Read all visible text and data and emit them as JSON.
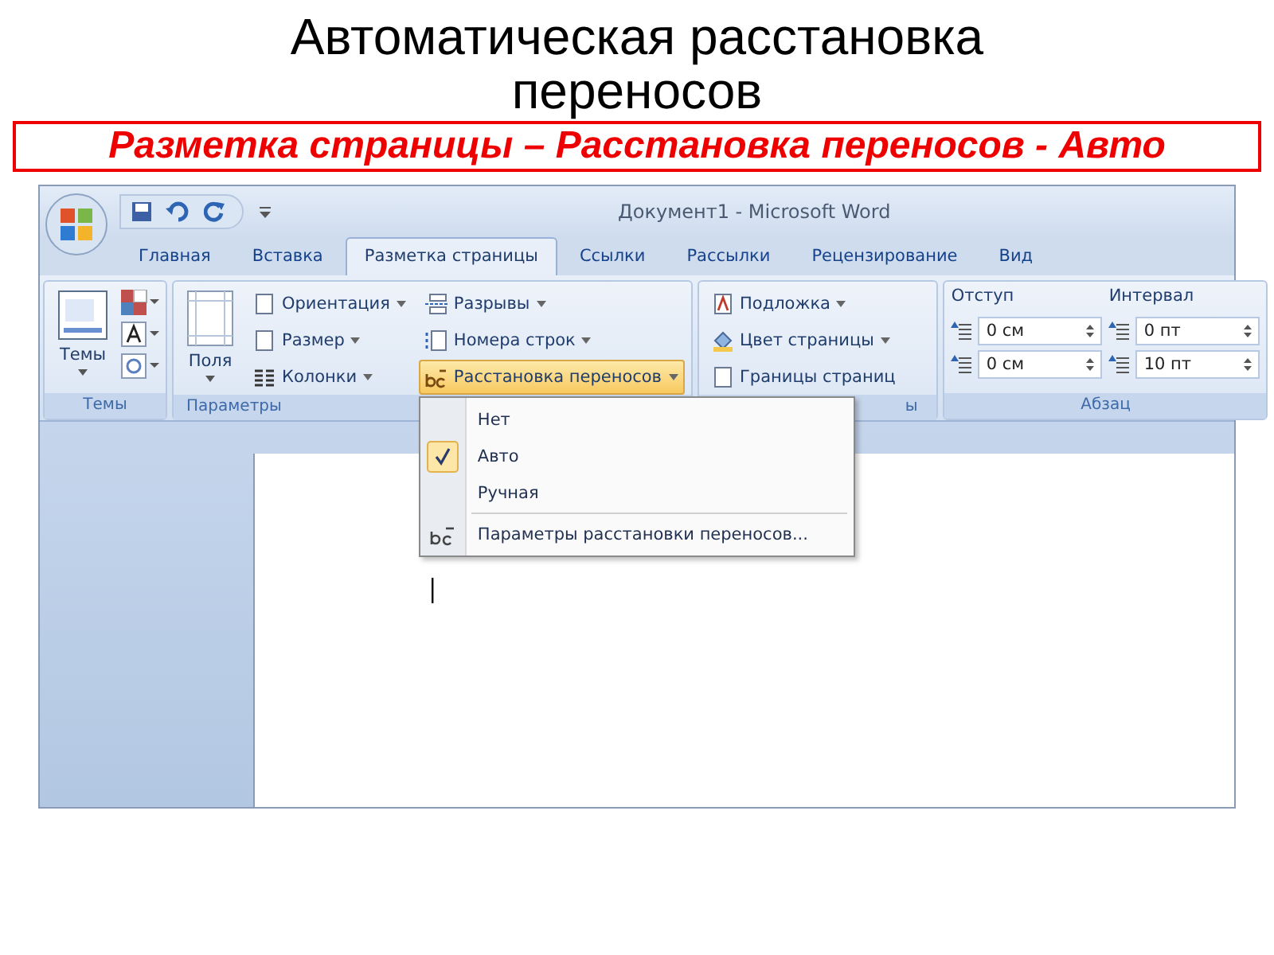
{
  "slide": {
    "title": "Автоматическая расстановка переносов",
    "subtitle": "Разметка страницы – Расстановка переносов - Авто"
  },
  "window": {
    "title": "Документ1 - Microsoft Word"
  },
  "tabs": [
    {
      "label": "Главная",
      "selected": false
    },
    {
      "label": "Вставка",
      "selected": false
    },
    {
      "label": "Разметка страницы",
      "selected": true
    },
    {
      "label": "Ссылки",
      "selected": false
    },
    {
      "label": "Рассылки",
      "selected": false
    },
    {
      "label": "Рецензирование",
      "selected": false
    },
    {
      "label": "Вид",
      "selected": false
    }
  ],
  "ribbon": {
    "groups": [
      {
        "kind": "themes",
        "label": "Темы",
        "big_button": "Темы"
      },
      {
        "kind": "buttons",
        "label": "Параметры",
        "big_button": "Поля",
        "columns": [
          [
            {
              "label": "Ориентация",
              "kind": "page",
              "dropdown": true,
              "selected": false
            },
            {
              "label": "Размер",
              "kind": "page",
              "dropdown": true,
              "selected": false
            },
            {
              "label": "Колонки",
              "kind": "columns",
              "dropdown": true,
              "selected": false
            }
          ],
          [
            {
              "label": "Разрывы",
              "kind": "breaks",
              "dropdown": true,
              "selected": false
            },
            {
              "label": "Номера строк",
              "kind": "lines",
              "dropdown": true,
              "selected": false
            },
            {
              "label": "Расстановка переносов",
              "kind": "hyphen",
              "dropdown": true,
              "selected": true
            }
          ]
        ]
      },
      {
        "kind": "buttons",
        "label": "ы",
        "columns": [
          [
            {
              "label": "Подложка",
              "kind": "watermark",
              "dropdown": true,
              "selected": false
            },
            {
              "label": "Цвет страницы",
              "kind": "fill",
              "dropdown": true,
              "selected": false
            },
            {
              "label": "Границы страниц",
              "kind": "page",
              "dropdown": false,
              "selected": false
            }
          ]
        ]
      },
      {
        "kind": "paragraph",
        "label": "Абзац",
        "sections": [
          {
            "label": "Отступ",
            "fields": [
              "0 см",
              "0 см"
            ]
          },
          {
            "label": "Интервал",
            "fields": [
              "0 пт",
              "10 пт"
            ]
          }
        ]
      }
    ]
  },
  "menu": {
    "items": [
      {
        "kind": "option",
        "label": "Нет",
        "checked": false
      },
      {
        "kind": "option",
        "label": "Авто",
        "checked": true
      },
      {
        "kind": "option",
        "label": "Ручная",
        "checked": false
      },
      {
        "kind": "command",
        "label": "Параметры расстановки переносов..."
      }
    ]
  }
}
